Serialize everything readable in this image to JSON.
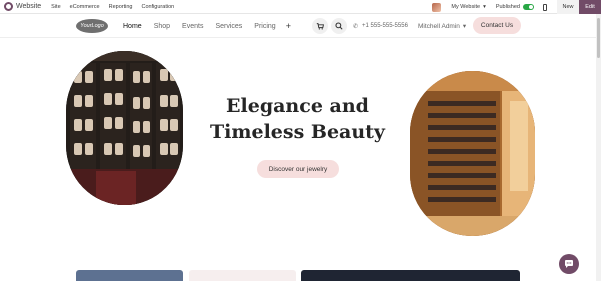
{
  "admin_bar": {
    "app_name": "Website",
    "menu": [
      "Site",
      "eCommerce",
      "Reporting",
      "Configuration"
    ],
    "site_switch": "My Website",
    "published_label": "Published",
    "new_label": "New",
    "edit_label": "Edit"
  },
  "header": {
    "logo_text": "YourLogo",
    "nav": [
      {
        "label": "Home"
      },
      {
        "label": "Shop"
      },
      {
        "label": "Events"
      },
      {
        "label": "Services"
      },
      {
        "label": "Pricing"
      }
    ],
    "add_label": "+",
    "phone": "+1 555-555-5556",
    "user": "Mitchell Admin",
    "contact_button": "Contact Us"
  },
  "hero": {
    "title_line1": "Elegance and",
    "title_line2": "Timeless Beauty",
    "button": "Discover our jewelry"
  },
  "colors": {
    "brand": "#714b67",
    "accent_pink": "#f6dedd",
    "toggle_on": "#28a745"
  }
}
